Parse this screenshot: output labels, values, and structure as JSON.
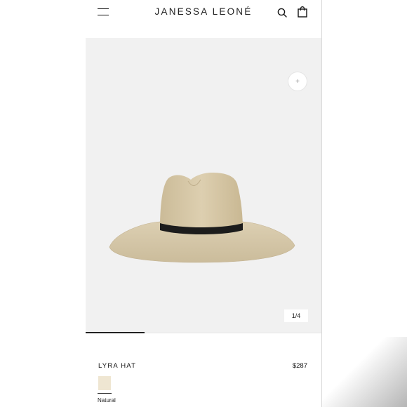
{
  "header": {
    "brand": "JANESSA LEONÉ",
    "icons": [
      "menu-icon",
      "search-icon",
      "bag-icon"
    ]
  },
  "gallery": {
    "zoom_symbol": "+",
    "counter": "1/4",
    "progress": 0.25,
    "background": "#f1f1f1"
  },
  "product": {
    "name": "LYRA HAT",
    "price": "$287",
    "color_name": "Natural",
    "swatch_color": "#efe6d2",
    "hat_color": "#d8c9a8",
    "band_color": "#1c1c1c"
  }
}
